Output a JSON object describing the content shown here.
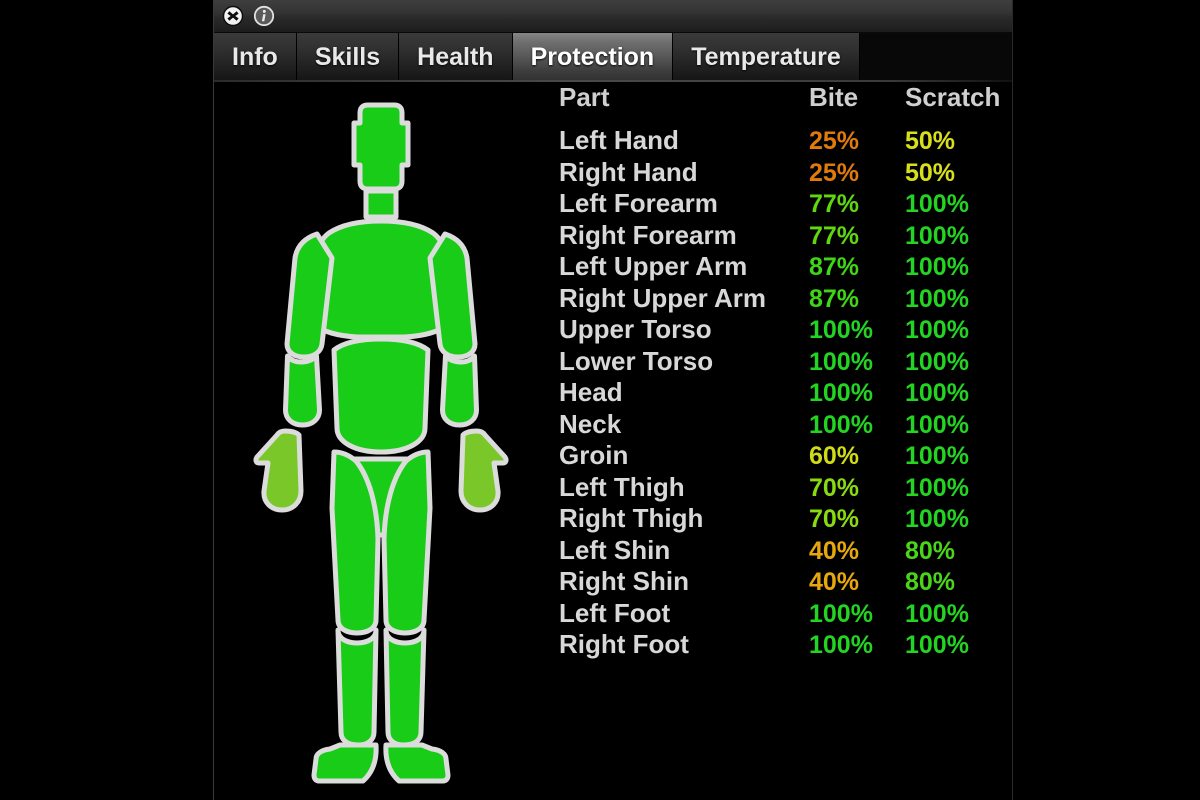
{
  "window": {
    "titlebar": {
      "close_icon": "close-circle-icon",
      "info_icon": "info-circle-icon"
    },
    "tabs": [
      {
        "label": "Info",
        "active": false
      },
      {
        "label": "Skills",
        "active": false
      },
      {
        "label": "Health",
        "active": false
      },
      {
        "label": "Protection",
        "active": true
      },
      {
        "label": "Temperature",
        "active": false
      }
    ]
  },
  "table": {
    "columns": [
      "Part",
      "Bite",
      "Scratch"
    ],
    "rows": [
      {
        "part": "Left Hand",
        "bite": "25%",
        "scratch": "50%",
        "bite_color": "#e07a0c",
        "scratch_color": "#d8e01a"
      },
      {
        "part": "Right Hand",
        "bite": "25%",
        "scratch": "50%",
        "bite_color": "#e07a0c",
        "scratch_color": "#d8e01a"
      },
      {
        "part": "Left Forearm",
        "bite": "77%",
        "scratch": "100%",
        "bite_color": "#5fd80f",
        "scratch_color": "#23d423"
      },
      {
        "part": "Right Forearm",
        "bite": "77%",
        "scratch": "100%",
        "bite_color": "#5fd80f",
        "scratch_color": "#23d423"
      },
      {
        "part": "Left Upper Arm",
        "bite": "87%",
        "scratch": "100%",
        "bite_color": "#3fd616",
        "scratch_color": "#23d423"
      },
      {
        "part": "Right Upper Arm",
        "bite": "87%",
        "scratch": "100%",
        "bite_color": "#3fd616",
        "scratch_color": "#23d423"
      },
      {
        "part": "Upper Torso",
        "bite": "100%",
        "scratch": "100%",
        "bite_color": "#23d423",
        "scratch_color": "#23d423"
      },
      {
        "part": "Lower Torso",
        "bite": "100%",
        "scratch": "100%",
        "bite_color": "#23d423",
        "scratch_color": "#23d423"
      },
      {
        "part": "Head",
        "bite": "100%",
        "scratch": "100%",
        "bite_color": "#23d423",
        "scratch_color": "#23d423"
      },
      {
        "part": "Neck",
        "bite": "100%",
        "scratch": "100%",
        "bite_color": "#23d423",
        "scratch_color": "#23d423"
      },
      {
        "part": "Groin",
        "bite": "60%",
        "scratch": "100%",
        "bite_color": "#cfdc16",
        "scratch_color": "#23d423"
      },
      {
        "part": "Left Thigh",
        "bite": "70%",
        "scratch": "100%",
        "bite_color": "#8ada12",
        "scratch_color": "#23d423"
      },
      {
        "part": "Right Thigh",
        "bite": "70%",
        "scratch": "100%",
        "bite_color": "#8ada12",
        "scratch_color": "#23d423"
      },
      {
        "part": "Left Shin",
        "bite": "40%",
        "scratch": "80%",
        "bite_color": "#e8a70c",
        "scratch_color": "#4ad618"
      },
      {
        "part": "Right Shin",
        "bite": "40%",
        "scratch": "80%",
        "bite_color": "#e8a70c",
        "scratch_color": "#4ad618"
      },
      {
        "part": "Left Foot",
        "bite": "100%",
        "scratch": "100%",
        "bite_color": "#23d423",
        "scratch_color": "#23d423"
      },
      {
        "part": "Right Foot",
        "bite": "100%",
        "scratch": "100%",
        "bite_color": "#23d423",
        "scratch_color": "#23d423"
      }
    ]
  },
  "body_figure": {
    "outline_color": "#dcdcdc",
    "default_fill": "#18cc18",
    "parts": {
      "head": "#18cc18",
      "neck": "#18cc18",
      "upper_torso": "#18cc18",
      "lower_torso": "#18cc18",
      "left_upper_arm": "#18cc18",
      "right_upper_arm": "#18cc18",
      "left_forearm": "#18cc18",
      "right_forearm": "#18cc18",
      "left_hand": "#7ac72a",
      "right_hand": "#7ac72a",
      "groin": "#18cc18",
      "left_thigh": "#18cc18",
      "right_thigh": "#18cc18",
      "left_shin": "#18cc18",
      "right_shin": "#18cc18",
      "left_foot": "#18cc18",
      "right_foot": "#18cc18"
    }
  },
  "colors": {
    "background": "#000000",
    "panel_background": "#000000",
    "header_text": "#cfcfcf",
    "part_text": "#d8d8d8",
    "tab_active_text": "#ffffff",
    "tab_text": "#e9e9e9"
  }
}
